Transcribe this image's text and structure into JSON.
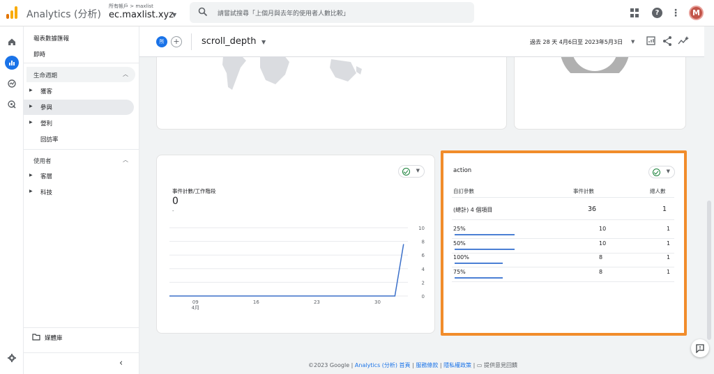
{
  "app": {
    "title": "Analytics (分析)",
    "account_path": "所有帳戶 > maxlist",
    "account_name": "ec.maxlist.xyz"
  },
  "search": {
    "placeholder": "請嘗試搜尋「上個月與去年的使用者人數比較」"
  },
  "header_icons": [
    "apps-icon",
    "help-icon",
    "more-icon"
  ],
  "user": {
    "avatar_letter": "M"
  },
  "nav": {
    "section_title": "報表數據匯報",
    "realtime": "即時",
    "lifecycle": {
      "label": "生命週期",
      "items": [
        {
          "label": "獲客"
        },
        {
          "label": "參與"
        },
        {
          "label": "營利"
        },
        {
          "label": "回訪率"
        }
      ]
    },
    "user": {
      "label": "使用者",
      "items": [
        {
          "label": "客層"
        },
        {
          "label": "科技"
        }
      ]
    },
    "library": "媒體庫"
  },
  "subbar": {
    "compare_chip": "所",
    "add_chip": "+",
    "report_title": "scroll_depth",
    "date_range": "過去 28 天   4月6日至 2023年5月3日"
  },
  "chart_card": {
    "metric_label": "事件計數/工作階段",
    "metric_value": "0",
    "metric_sub": "-"
  },
  "chart_data": {
    "type": "line",
    "x": [
      "4月6日",
      "4月7日",
      "4月8日",
      "4月9日",
      "4月10日",
      "4月11日",
      "4月12日",
      "4月13日",
      "4月14日",
      "4月15日",
      "4月16日",
      "4月17日",
      "4月18日",
      "4月19日",
      "4月20日",
      "4月21日",
      "4月22日",
      "4月23日",
      "4月24日",
      "4月25日",
      "4月26日",
      "4月27日",
      "4月28日",
      "4月29日",
      "4月30日",
      "5月1日",
      "5月2日",
      "5月3日"
    ],
    "series": [
      {
        "values": [
          0,
          0,
          0,
          0,
          0,
          0,
          0,
          0,
          0,
          0,
          0,
          0,
          0,
          0,
          0,
          0,
          0,
          0,
          0,
          0,
          0,
          0,
          0,
          0,
          0,
          0,
          0,
          7.6
        ]
      }
    ],
    "x_tick_labels": [
      "09",
      "16",
      "23",
      "30"
    ],
    "x_month_label": "4月",
    "y_ticks": [
      "0",
      "2",
      "4",
      "6",
      "8",
      "10"
    ],
    "ylim": [
      0,
      10
    ],
    "grid": true,
    "line_color": "#3a6fc9"
  },
  "table_card": {
    "title": "action",
    "headers": [
      "自訂參數",
      "事件計數",
      "總人數"
    ],
    "total": {
      "label": "(總計) 4 個項目",
      "events": "36",
      "users": "1"
    },
    "rows": [
      {
        "label": "25%",
        "events": "10",
        "users": "1",
        "bar": 1.0
      },
      {
        "label": "50%",
        "events": "10",
        "users": "1",
        "bar": 1.0
      },
      {
        "label": "100%",
        "events": "8",
        "users": "1",
        "bar": 0.8
      },
      {
        "label": "75%",
        "events": "8",
        "users": "1",
        "bar": 0.8
      }
    ]
  },
  "footer": {
    "copyright": "©2023 Google | ",
    "home": "Analytics (分析) 首頁",
    "sep1": " | ",
    "terms": "服務條款",
    "sep2": " | ",
    "privacy": "隱私權政策",
    "sep3": " | ",
    "feedback": "提供意見回饋"
  },
  "colors": {
    "accent": "#1a73e8",
    "highlight_border": "#f18c2b",
    "bar": "#4a7fd4",
    "check": "#188038"
  }
}
